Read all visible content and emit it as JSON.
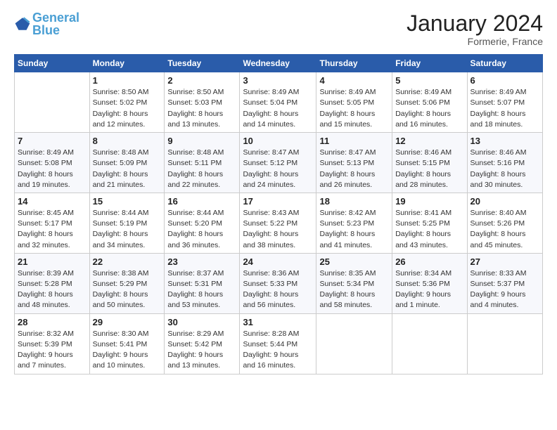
{
  "logo": {
    "text_general": "General",
    "text_blue": "Blue"
  },
  "header": {
    "month": "January 2024",
    "location": "Formerie, France"
  },
  "columns": [
    "Sunday",
    "Monday",
    "Tuesday",
    "Wednesday",
    "Thursday",
    "Friday",
    "Saturday"
  ],
  "weeks": [
    [
      {
        "day": "",
        "info": ""
      },
      {
        "day": "1",
        "info": "Sunrise: 8:50 AM\nSunset: 5:02 PM\nDaylight: 8 hours\nand 12 minutes."
      },
      {
        "day": "2",
        "info": "Sunrise: 8:50 AM\nSunset: 5:03 PM\nDaylight: 8 hours\nand 13 minutes."
      },
      {
        "day": "3",
        "info": "Sunrise: 8:49 AM\nSunset: 5:04 PM\nDaylight: 8 hours\nand 14 minutes."
      },
      {
        "day": "4",
        "info": "Sunrise: 8:49 AM\nSunset: 5:05 PM\nDaylight: 8 hours\nand 15 minutes."
      },
      {
        "day": "5",
        "info": "Sunrise: 8:49 AM\nSunset: 5:06 PM\nDaylight: 8 hours\nand 16 minutes."
      },
      {
        "day": "6",
        "info": "Sunrise: 8:49 AM\nSunset: 5:07 PM\nDaylight: 8 hours\nand 18 minutes."
      }
    ],
    [
      {
        "day": "7",
        "info": "Sunrise: 8:49 AM\nSunset: 5:08 PM\nDaylight: 8 hours\nand 19 minutes."
      },
      {
        "day": "8",
        "info": "Sunrise: 8:48 AM\nSunset: 5:09 PM\nDaylight: 8 hours\nand 21 minutes."
      },
      {
        "day": "9",
        "info": "Sunrise: 8:48 AM\nSunset: 5:11 PM\nDaylight: 8 hours\nand 22 minutes."
      },
      {
        "day": "10",
        "info": "Sunrise: 8:47 AM\nSunset: 5:12 PM\nDaylight: 8 hours\nand 24 minutes."
      },
      {
        "day": "11",
        "info": "Sunrise: 8:47 AM\nSunset: 5:13 PM\nDaylight: 8 hours\nand 26 minutes."
      },
      {
        "day": "12",
        "info": "Sunrise: 8:46 AM\nSunset: 5:15 PM\nDaylight: 8 hours\nand 28 minutes."
      },
      {
        "day": "13",
        "info": "Sunrise: 8:46 AM\nSunset: 5:16 PM\nDaylight: 8 hours\nand 30 minutes."
      }
    ],
    [
      {
        "day": "14",
        "info": "Sunrise: 8:45 AM\nSunset: 5:17 PM\nDaylight: 8 hours\nand 32 minutes."
      },
      {
        "day": "15",
        "info": "Sunrise: 8:44 AM\nSunset: 5:19 PM\nDaylight: 8 hours\nand 34 minutes."
      },
      {
        "day": "16",
        "info": "Sunrise: 8:44 AM\nSunset: 5:20 PM\nDaylight: 8 hours\nand 36 minutes."
      },
      {
        "day": "17",
        "info": "Sunrise: 8:43 AM\nSunset: 5:22 PM\nDaylight: 8 hours\nand 38 minutes."
      },
      {
        "day": "18",
        "info": "Sunrise: 8:42 AM\nSunset: 5:23 PM\nDaylight: 8 hours\nand 41 minutes."
      },
      {
        "day": "19",
        "info": "Sunrise: 8:41 AM\nSunset: 5:25 PM\nDaylight: 8 hours\nand 43 minutes."
      },
      {
        "day": "20",
        "info": "Sunrise: 8:40 AM\nSunset: 5:26 PM\nDaylight: 8 hours\nand 45 minutes."
      }
    ],
    [
      {
        "day": "21",
        "info": "Sunrise: 8:39 AM\nSunset: 5:28 PM\nDaylight: 8 hours\nand 48 minutes."
      },
      {
        "day": "22",
        "info": "Sunrise: 8:38 AM\nSunset: 5:29 PM\nDaylight: 8 hours\nand 50 minutes."
      },
      {
        "day": "23",
        "info": "Sunrise: 8:37 AM\nSunset: 5:31 PM\nDaylight: 8 hours\nand 53 minutes."
      },
      {
        "day": "24",
        "info": "Sunrise: 8:36 AM\nSunset: 5:33 PM\nDaylight: 8 hours\nand 56 minutes."
      },
      {
        "day": "25",
        "info": "Sunrise: 8:35 AM\nSunset: 5:34 PM\nDaylight: 8 hours\nand 58 minutes."
      },
      {
        "day": "26",
        "info": "Sunrise: 8:34 AM\nSunset: 5:36 PM\nDaylight: 9 hours\nand 1 minute."
      },
      {
        "day": "27",
        "info": "Sunrise: 8:33 AM\nSunset: 5:37 PM\nDaylight: 9 hours\nand 4 minutes."
      }
    ],
    [
      {
        "day": "28",
        "info": "Sunrise: 8:32 AM\nSunset: 5:39 PM\nDaylight: 9 hours\nand 7 minutes."
      },
      {
        "day": "29",
        "info": "Sunrise: 8:30 AM\nSunset: 5:41 PM\nDaylight: 9 hours\nand 10 minutes."
      },
      {
        "day": "30",
        "info": "Sunrise: 8:29 AM\nSunset: 5:42 PM\nDaylight: 9 hours\nand 13 minutes."
      },
      {
        "day": "31",
        "info": "Sunrise: 8:28 AM\nSunset: 5:44 PM\nDaylight: 9 hours\nand 16 minutes."
      },
      {
        "day": "",
        "info": ""
      },
      {
        "day": "",
        "info": ""
      },
      {
        "day": "",
        "info": ""
      }
    ]
  ]
}
